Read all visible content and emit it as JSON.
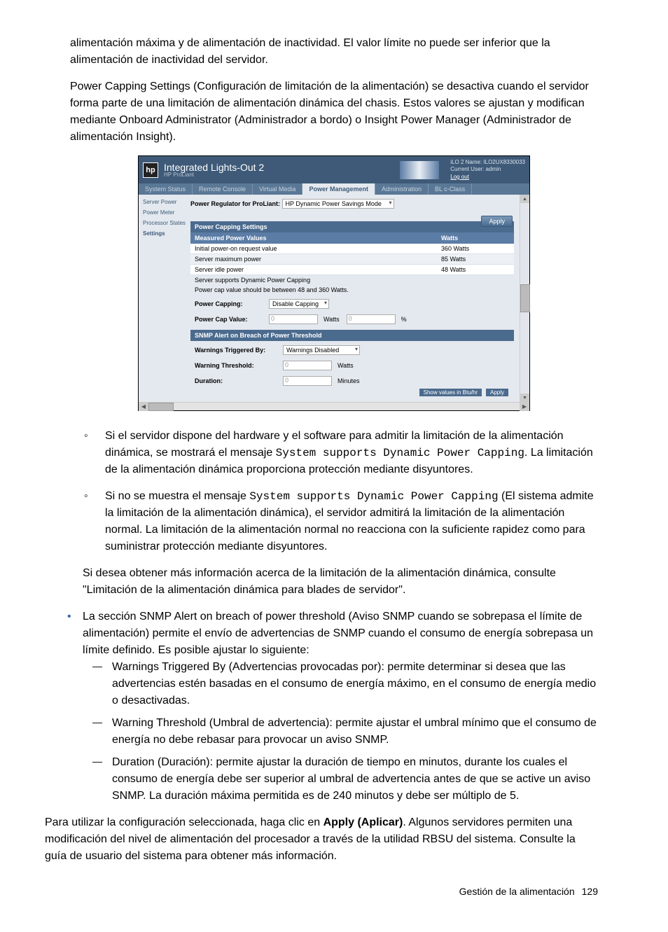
{
  "paragraphs": {
    "p1": "alimentación máxima y de alimentación de inactividad. El valor límite no puede ser inferior que la alimentación de inactividad del servidor.",
    "p2": "Power Capping Settings (Configuración de limitación de la alimentación) se desactiva cuando el servidor forma parte de una limitación de alimentación dinámica del chasis. Estos valores se ajustan y modifican mediante Onboard Administrator (Administrador a bordo) o Insight Power Manager (Administrador de alimentación Insight).",
    "p3": "Si desea obtener más información acerca de la limitación de la alimentación dinámica, consulte \"Limitación de la alimentación dinámica para blades de servidor\".",
    "p4_pre": "Para utilizar la configuración seleccionada, haga clic en ",
    "p4_bold": "Apply (Aplicar)",
    "p4_post": ". Algunos servidores permiten una modificación del nivel de alimentación del procesador a través de la utilidad RBSU del sistema. Consulte la guía de usuario del sistema para obtener más información."
  },
  "circ_items": [
    {
      "pre": "Si el servidor dispone del hardware y el software para admitir la limitación de la alimentación dinámica, se mostrará el mensaje ",
      "code": "System supports Dynamic Power Capping",
      "post": ". La limitación de la alimentación dinámica proporciona protección mediante disyuntores."
    },
    {
      "pre": "Si no se muestra el mensaje ",
      "code": "System supports Dynamic Power Capping",
      "post": " (El sistema admite la limitación de la alimentación dinámica), el servidor admitirá la limitación de la alimentación normal. La limitación de la alimentación normal no reacciona con la suficiente rapidez como para suministrar protección mediante disyuntores."
    }
  ],
  "dot_item": "La sección SNMP Alert on breach of power threshold (Aviso SNMP cuando se sobrepasa el límite de alimentación) permite el envío de advertencias de SNMP cuando el consumo de energía sobrepasa un límite definido. Es posible ajustar lo siguiente:",
  "dash_items": [
    "Warnings Triggered By (Advertencias provocadas por): permite determinar si desea que las advertencias estén basadas en el consumo de energía máximo, en el consumo de energía medio o desactivadas.",
    "Warning Threshold (Umbral de advertencia): permite ajustar el umbral mínimo que el consumo de energía no debe rebasar para provocar un aviso SNMP.",
    "Duration (Duración): permite ajustar la duración de tiempo en minutos, durante los cuales el consumo de energía debe ser superior al umbral de advertencia antes de que se active un aviso SNMP. La duración máxima permitida es de 240 minutos y debe ser múltiplo de 5."
  ],
  "screenshot": {
    "hp_logo": "hp",
    "title": "Integrated Lights-Out 2",
    "subtitle": "HP ProLiant",
    "header_right": {
      "name": "iLO 2 Name: ILO2UX8330033",
      "user": "Current User: admin",
      "logout": "Log out"
    },
    "tabs": [
      "System Status",
      "Remote Console",
      "Virtual Media",
      "Power Management",
      "Administration",
      "BL c-Class"
    ],
    "active_tab": 3,
    "sidebar": [
      "Server Power",
      "Power Meter",
      "Processor States",
      "Settings"
    ],
    "active_side": 3,
    "regulator": {
      "label": "Power Regulator for ProLiant:",
      "value": "HP Dynamic Power Savings Mode"
    },
    "apply": "Apply",
    "sections": {
      "capping": "Power Capping Settings",
      "measured_left": "Measured Power Values",
      "measured_right": "Watts",
      "snmp": "SNMP Alert on Breach of Power Threshold"
    },
    "table": [
      {
        "l": "Initial power-on request value",
        "r": "360 Watts"
      },
      {
        "l": "Server maximum power",
        "r": "85 Watts"
      },
      {
        "l": "Server idle power",
        "r": "48 Watts"
      }
    ],
    "notes": [
      "Server supports Dynamic Power Capping",
      "Power cap value should be between 48 and 360 Watts."
    ],
    "capping_form": {
      "pc_label": "Power Capping:",
      "pc_value": "Disable Capping",
      "pcv_label": "Power Cap Value:",
      "pcv_watts": "0",
      "pcv_watts_unit": "Watts",
      "pcv_pct": "0",
      "pcv_pct_unit": "%"
    },
    "snmp_form": {
      "wt_label": "Warnings Triggered By:",
      "wt_value": "Warnings Disabled",
      "wth_label": "Warning Threshold:",
      "wth_value": "0",
      "wth_unit": "Watts",
      "dur_label": "Duration:",
      "dur_value": "0",
      "dur_unit": "Minutes"
    },
    "status_chip1": "Show values in Btu/hr",
    "status_chip2": "Apply"
  },
  "footer": {
    "section": "Gestión de la alimentación",
    "page": "129"
  }
}
